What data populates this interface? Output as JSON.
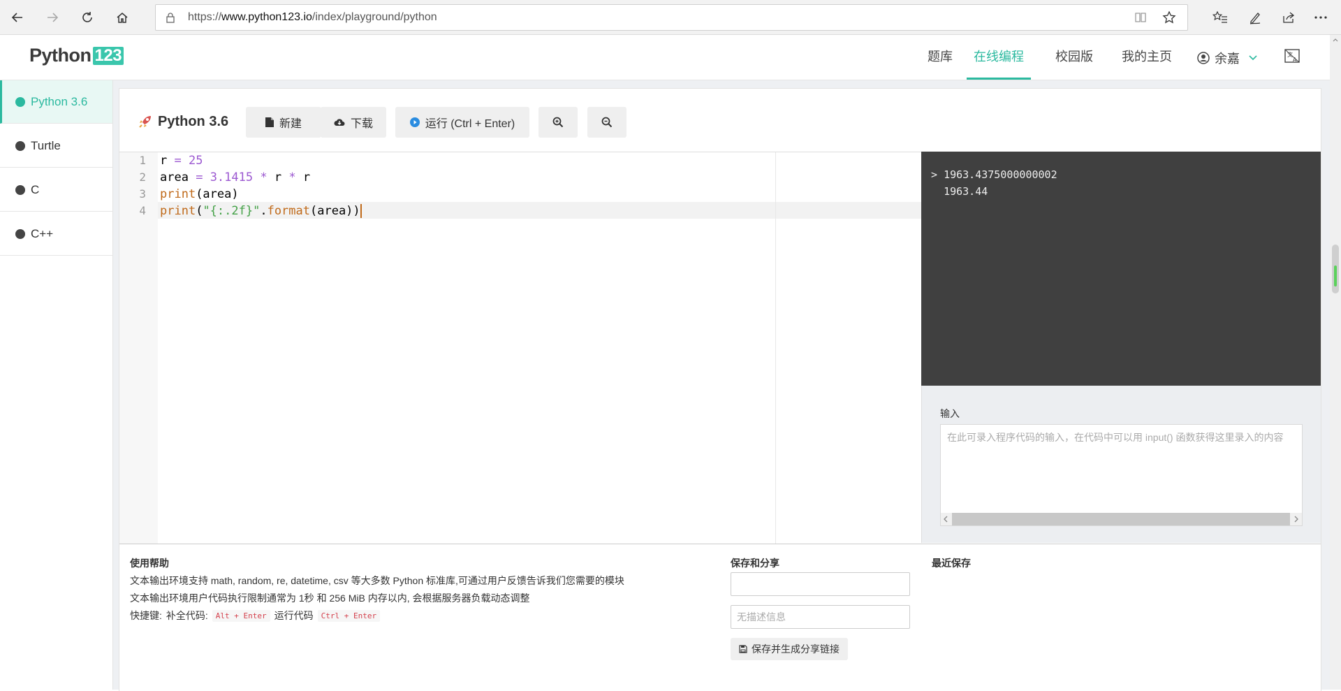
{
  "browser": {
    "url_prefix": "https://",
    "url_host": "www.python123.io",
    "url_path": "/index/playground/python"
  },
  "site": {
    "logo_text": "Python",
    "logo_num": "123",
    "nav": [
      "题库",
      "在线编程",
      "校园版",
      "我的主页"
    ],
    "user": "余嘉"
  },
  "sidebar": {
    "items": [
      {
        "label": "Python 3.6",
        "active": true
      },
      {
        "label": "Turtle"
      },
      {
        "label": "C"
      },
      {
        "label": "C++"
      }
    ]
  },
  "toolbar": {
    "title": "Python 3.6",
    "new_label": "新建",
    "download_label": "下载",
    "run_label": "运行 (Ctrl + Enter)"
  },
  "editor": {
    "line_numbers": [
      "1",
      "2",
      "3",
      "4"
    ],
    "lines": [
      "r = 25",
      "area = 3.1415 * r * r",
      "print(area)",
      "print(\"{:.2f}\".format(area))"
    ]
  },
  "output": {
    "prompt": ">",
    "lines": [
      "1963.4375000000002",
      "1963.44"
    ]
  },
  "input": {
    "label": "输入",
    "placeholder": "在此可录入程序代码的输入，在代码中可以用 input() 函数获得这里录入的内容"
  },
  "help": {
    "title": "使用帮助",
    "line1": "文本输出环境支持 math, random, re, datetime, csv 等大多数 Python 标准库,可通过用户反馈告诉我们您需要的模块",
    "line2": "文本输出环境用户代码执行限制通常为 1秒 和 256 MiB 内存以内, 会根据服务器负载动态调整",
    "shortcut_label": "快捷键:",
    "complete_label": "补全代码:",
    "complete_key": "Alt + Enter",
    "run_code_label": "运行代码",
    "run_key": "Ctrl + Enter"
  },
  "share": {
    "title": "保存和分享",
    "desc_placeholder": "无描述信息",
    "save_label": "保存并生成分享链接"
  },
  "recent": {
    "title": "最近保存"
  },
  "colors": {
    "accent": "#2bb99f",
    "output_bg": "#404040"
  }
}
